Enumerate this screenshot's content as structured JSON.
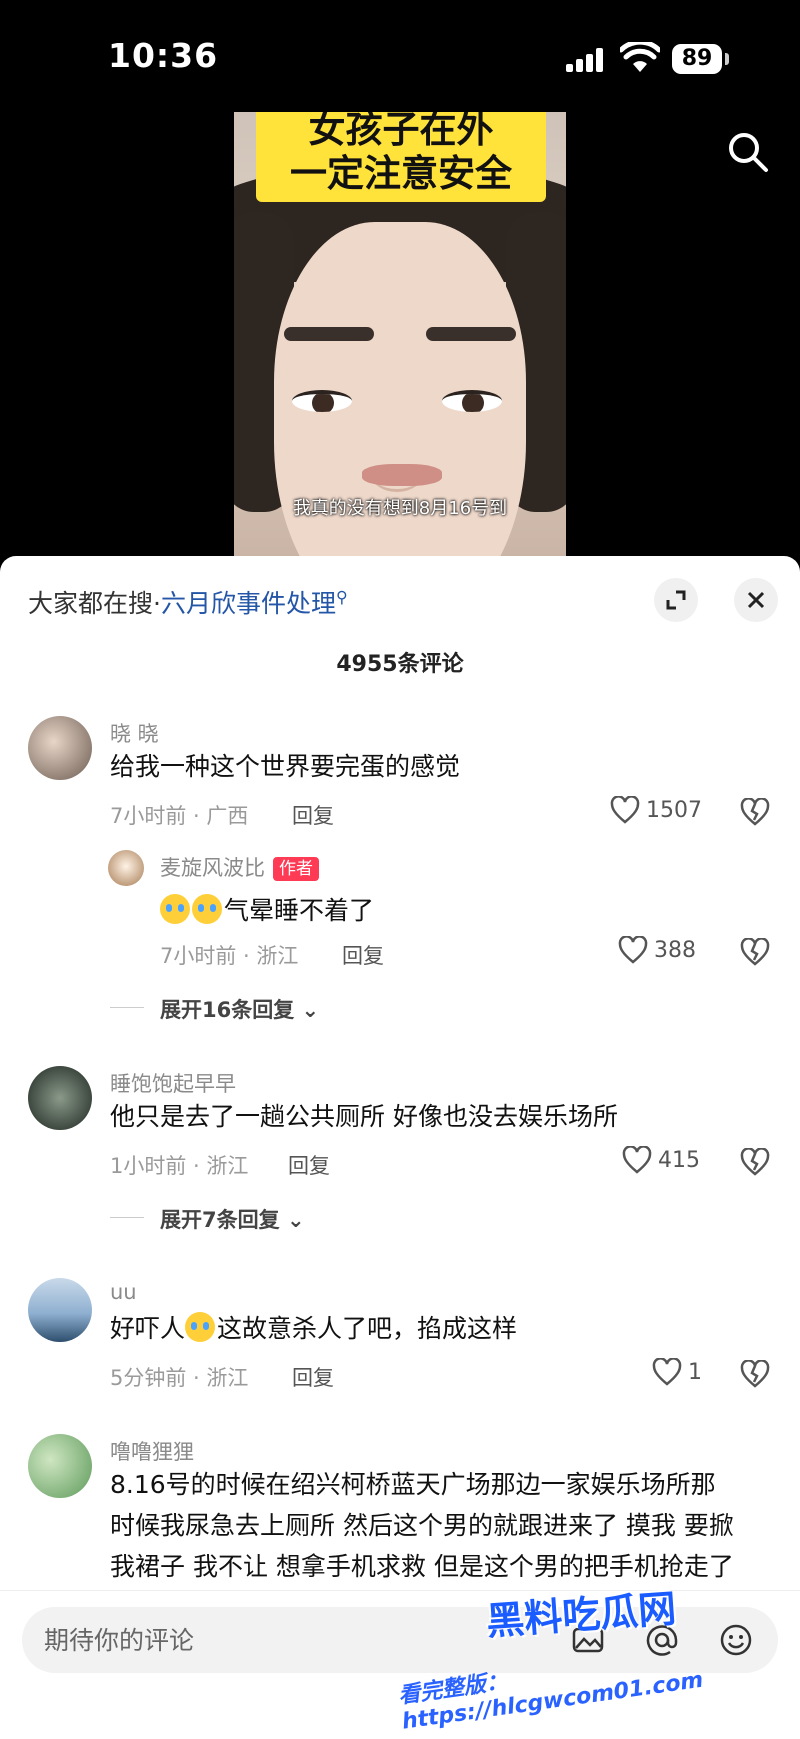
{
  "status": {
    "time": "10:36",
    "battery": "89"
  },
  "video": {
    "title_line1": "女孩子在外",
    "title_line2": "一定注意安全",
    "subtitle": "我真的没有想到8月16号到"
  },
  "sheet": {
    "trending_prefix": "大家都在搜·",
    "trending_link": "六月欣事件处理",
    "comment_count": "4955条评论"
  },
  "comments": [
    {
      "name": "晓 晓",
      "text": "给我一种这个世界要完蛋的感觉",
      "meta": "7小时前 · 广西",
      "reply": "回复",
      "likes": "1507"
    },
    {
      "name": "麦旋风波比",
      "badge": "作者",
      "text": "气晕睡不着了",
      "meta": "7小时前 · 浙江",
      "reply": "回复",
      "likes": "388"
    },
    {
      "expand": "展开16条回复"
    },
    {
      "name": "睡饱饱起早早",
      "text": "他只是去了一趟公共厕所 好像也没去娱乐场所",
      "meta": "1小时前 · 浙江",
      "reply": "回复",
      "likes": "415"
    },
    {
      "expand": "展开7条回复"
    },
    {
      "name": "uu",
      "text_a": "好吓人",
      "text_b": "这故意杀人了吧，掐成这样",
      "meta": "5分钟前 · 浙江",
      "reply": "回复",
      "likes": "1"
    },
    {
      "name": "噜噜狸狸",
      "line1": "8.16号的时候在绍兴柯桥蓝天广场那边一家娱乐场所那",
      "line2": "时候我尿急去上厕所 然后这个男的就跟进来了 摸我 要掀",
      "line3": "我裙子 我不让 想拿手机求救 但是这个男的把手机抢走了"
    }
  ],
  "input": {
    "placeholder": "期待你的评论"
  },
  "watermark": {
    "brand": "黑料吃瓜网",
    "url": "看完整版：https://hlcgwcom01.com"
  },
  "colors": {
    "accent_link": "#2456a8",
    "badge": "#ff3a55",
    "title_bg": "#ffe23a"
  }
}
